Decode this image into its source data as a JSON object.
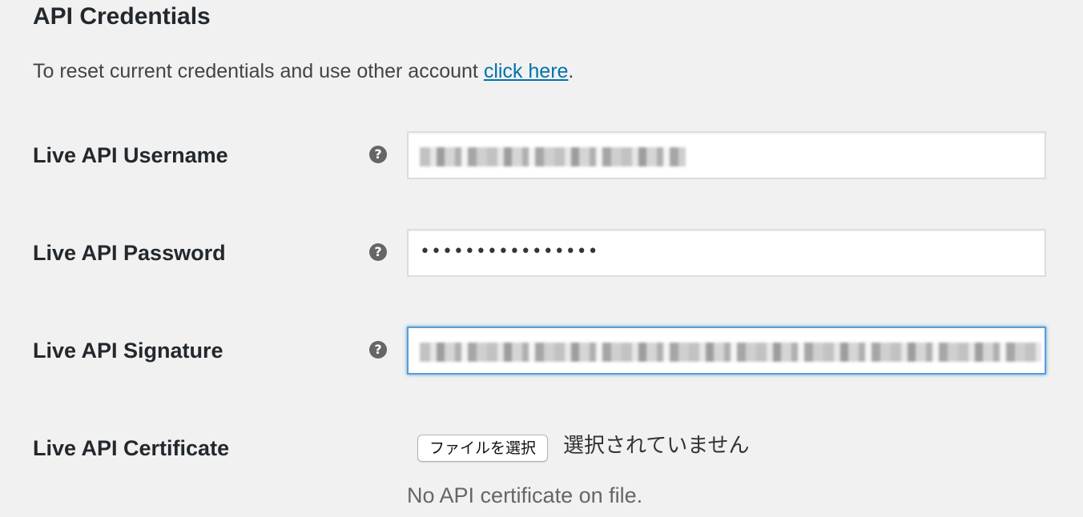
{
  "section": {
    "title": "API Credentials",
    "description_prefix": "To reset current credentials and use other account ",
    "description_link": "click here",
    "description_suffix": "."
  },
  "fields": {
    "username": {
      "label": "Live API Username",
      "help_icon": "question-circle-icon",
      "value_state": "obscured"
    },
    "password": {
      "label": "Live API Password",
      "help_icon": "question-circle-icon",
      "value": "••••••••••••••••"
    },
    "signature": {
      "label": "Live API Signature",
      "help_icon": "question-circle-icon",
      "value_state": "obscured",
      "focused": true
    },
    "certificate": {
      "label": "Live API Certificate",
      "button_label": "ファイルを選択",
      "status": "選択されていません",
      "note": "No API certificate on file."
    }
  },
  "colors": {
    "background": "#f1f1f1",
    "link": "#0073aa",
    "focus_border": "#5b9dd9",
    "help_icon": "#666666"
  }
}
